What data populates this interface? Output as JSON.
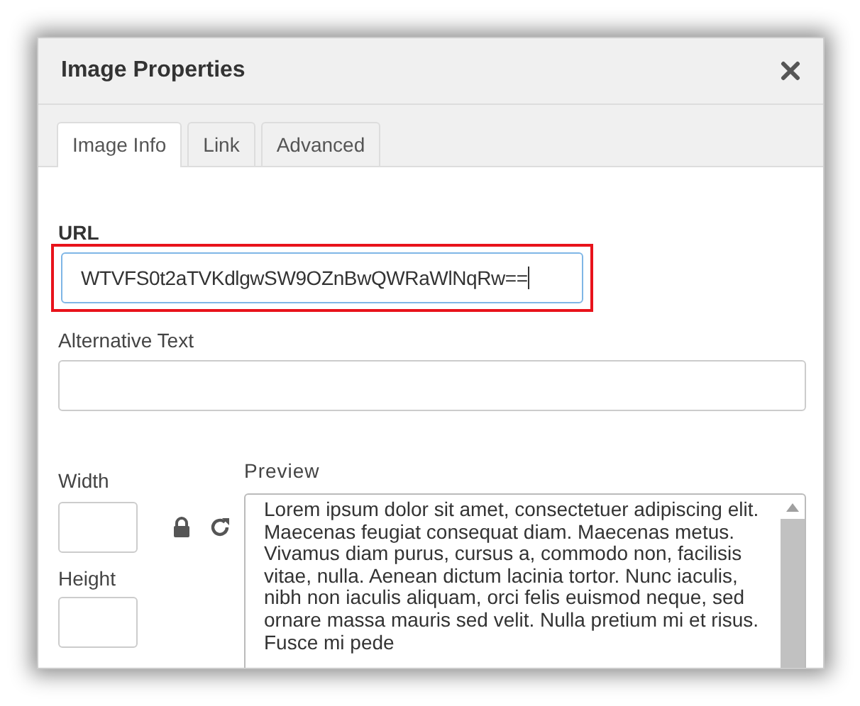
{
  "dialog": {
    "title": "Image Properties"
  },
  "tabs": [
    {
      "label": "Image Info",
      "selected": true
    },
    {
      "label": "Link",
      "selected": false
    },
    {
      "label": "Advanced",
      "selected": false
    }
  ],
  "url": {
    "label": "URL",
    "value": "WTVFS0t2aTVKdlgwSW9OZnBwQWRaWlNqRw==",
    "highlighted": true
  },
  "alternative_text": {
    "label": "Alternative Text"
  },
  "width": {
    "label": "Width"
  },
  "height": {
    "label": "Height"
  },
  "preview": {
    "label": "Preview",
    "text": "Lorem ipsum dolor sit amet, consectetuer adipiscing elit. Maecenas feugiat consequat diam. Maecenas metus. Vivamus diam purus, cursus a, commodo non, facilisis vitae, nulla. Aenean dictum lacinia tortor. Nunc iaculis, nibh non iaculis aliquam, orci felis euismod neque, sed ornare massa mauris sed velit. Nulla pretium mi et risus. Fusce mi pede"
  }
}
